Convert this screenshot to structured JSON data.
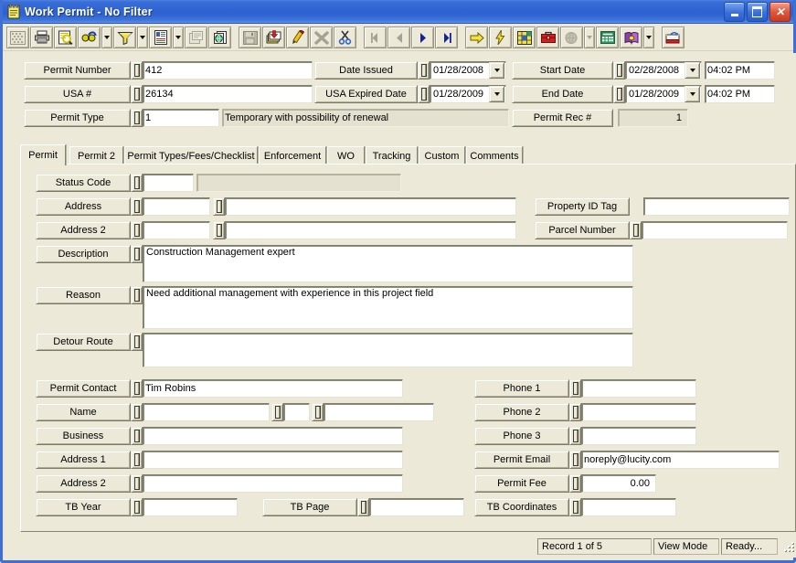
{
  "window": {
    "title": "Work Permit - No Filter",
    "icon": "notepad-icon",
    "minimize_label": "Minimize",
    "maximize_label": "Maximize",
    "close_label": "Close"
  },
  "toolbar": {
    "items": [
      {
        "name": "grid-view-icon",
        "label": "Grid View",
        "enabled": false
      },
      {
        "name": "print-icon",
        "label": "Print",
        "enabled": true
      },
      {
        "name": "print-preview-icon",
        "label": "Print Preview",
        "enabled": true
      },
      {
        "name": "find-icon",
        "label": "Find",
        "enabled": true
      },
      {
        "name": "find-dropdown-icon",
        "label": "Find Options",
        "enabled": true,
        "kind": "dropdown"
      },
      {
        "name": "filter-icon",
        "label": "Filter",
        "enabled": true
      },
      {
        "name": "filter-dropdown-icon",
        "label": "Filter Options",
        "enabled": true,
        "kind": "dropdown"
      },
      {
        "name": "report-icon",
        "label": "Reports",
        "enabled": true
      },
      {
        "name": "report-dropdown-icon",
        "label": "Report Options",
        "enabled": true,
        "kind": "dropdown"
      },
      {
        "name": "form-properties-icon",
        "label": "Form Properties",
        "enabled": false
      },
      {
        "name": "web-document-icon",
        "label": "Documents",
        "enabled": true
      },
      {
        "name": "separator",
        "label": "",
        "kind": "separator"
      },
      {
        "name": "save-icon",
        "label": "Save",
        "enabled": false
      },
      {
        "name": "add-record-icon",
        "label": "Add Record",
        "enabled": true
      },
      {
        "name": "edit-icon",
        "label": "Edit",
        "enabled": true
      },
      {
        "name": "delete-icon",
        "label": "Delete",
        "enabled": false
      },
      {
        "name": "cut-icon",
        "label": "Cut",
        "enabled": true
      },
      {
        "name": "separator",
        "label": "",
        "kind": "separator"
      },
      {
        "name": "first-record-icon",
        "label": "First Record",
        "enabled": false
      },
      {
        "name": "previous-record-icon",
        "label": "Previous Record",
        "enabled": false
      },
      {
        "name": "next-record-icon",
        "label": "Next Record",
        "enabled": true
      },
      {
        "name": "last-record-icon",
        "label": "Last Record",
        "enabled": true
      },
      {
        "name": "separator",
        "label": "",
        "kind": "separator"
      },
      {
        "name": "goto-icon",
        "label": "Go To",
        "enabled": true
      },
      {
        "name": "lightning-icon",
        "label": "Quick Action",
        "enabled": true
      },
      {
        "name": "map-icon",
        "label": "Map",
        "enabled": true
      },
      {
        "name": "toolkit-icon",
        "label": "Toolkit",
        "enabled": true
      },
      {
        "name": "globe-icon",
        "label": "Globe",
        "enabled": false
      },
      {
        "name": "globe-dropdown-icon",
        "label": "Globe Options",
        "enabled": false,
        "kind": "dropdown"
      },
      {
        "name": "calculator-icon",
        "label": "Calculator",
        "enabled": true
      },
      {
        "name": "book-icon",
        "label": "Library",
        "enabled": true
      },
      {
        "name": "book-dropdown-icon",
        "label": "Library Options",
        "enabled": true,
        "kind": "dropdown"
      },
      {
        "name": "separator",
        "label": "",
        "kind": "separator"
      },
      {
        "name": "exit-icon",
        "label": "Exit",
        "enabled": true
      }
    ]
  },
  "header": {
    "permit_number": {
      "label": "Permit Number",
      "value": "412"
    },
    "usa_number": {
      "label": "USA #",
      "value": "26134"
    },
    "permit_type": {
      "label": "Permit Type",
      "code": "1",
      "description": "Temporary with possibility of renewal"
    },
    "date_issued": {
      "label": "Date Issued",
      "value": "01/28/2008"
    },
    "usa_expired_date": {
      "label": "USA Expired Date",
      "value": "01/28/2009"
    },
    "start_date": {
      "label": "Start Date",
      "value": "02/28/2008",
      "time": "04:02 PM"
    },
    "end_date": {
      "label": "End Date",
      "value": "01/28/2009",
      "time": "04:02 PM"
    },
    "permit_rec_number": {
      "label": "Permit Rec #",
      "value": "1"
    }
  },
  "tabs": [
    {
      "label": "Permit",
      "active": true
    },
    {
      "label": "Permit 2",
      "active": false
    },
    {
      "label": "Permit Types/Fees/Checklist",
      "active": false
    },
    {
      "label": "Enforcement",
      "active": false
    },
    {
      "label": "WO",
      "active": false
    },
    {
      "label": "Tracking",
      "active": false
    },
    {
      "label": "Custom",
      "active": false
    },
    {
      "label": "Comments",
      "active": false
    }
  ],
  "permit_tab": {
    "status_code": {
      "label": "Status Code",
      "value": "",
      "description": ""
    },
    "address": {
      "label": "Address",
      "number": "",
      "street": ""
    },
    "address_2": {
      "label": "Address 2",
      "number": "",
      "street": ""
    },
    "property_id_tag": {
      "label": "Property ID Tag",
      "value": ""
    },
    "parcel_number": {
      "label": "Parcel Number",
      "value": ""
    },
    "description": {
      "label": "Description",
      "value": "Construction Management expert"
    },
    "reason": {
      "label": "Reason",
      "value": "Need additional management with experience in this project field"
    },
    "detour_route": {
      "label": "Detour Route",
      "value": ""
    },
    "permit_contact": {
      "label": "Permit Contact",
      "value": "Tim Robins"
    },
    "name": {
      "label": "Name",
      "first": "",
      "middle": "",
      "last": ""
    },
    "business": {
      "label": "Business",
      "value": ""
    },
    "address_1_contact": {
      "label": "Address 1",
      "value": ""
    },
    "address_2_contact": {
      "label": "Address 2",
      "value": ""
    },
    "tb_year": {
      "label": "TB Year",
      "value": ""
    },
    "tb_page": {
      "label": "TB Page",
      "value": ""
    },
    "phone_1": {
      "label": "Phone 1",
      "value": ""
    },
    "phone_2": {
      "label": "Phone 2",
      "value": ""
    },
    "phone_3": {
      "label": "Phone 3",
      "value": ""
    },
    "permit_email": {
      "label": "Permit Email",
      "value": "noreply@lucity.com"
    },
    "permit_fee": {
      "label": "Permit Fee",
      "value": "0.00"
    },
    "tb_coordinates": {
      "label": "TB Coordinates",
      "value": ""
    }
  },
  "statusbar": {
    "record": "Record 1 of 5",
    "mode": "View Mode",
    "state": "Ready..."
  },
  "colors": {
    "title_active": "#2f63d2",
    "face": "#ece9d8",
    "field": "#ffffff",
    "readonly_field": "#e4e1d0"
  }
}
